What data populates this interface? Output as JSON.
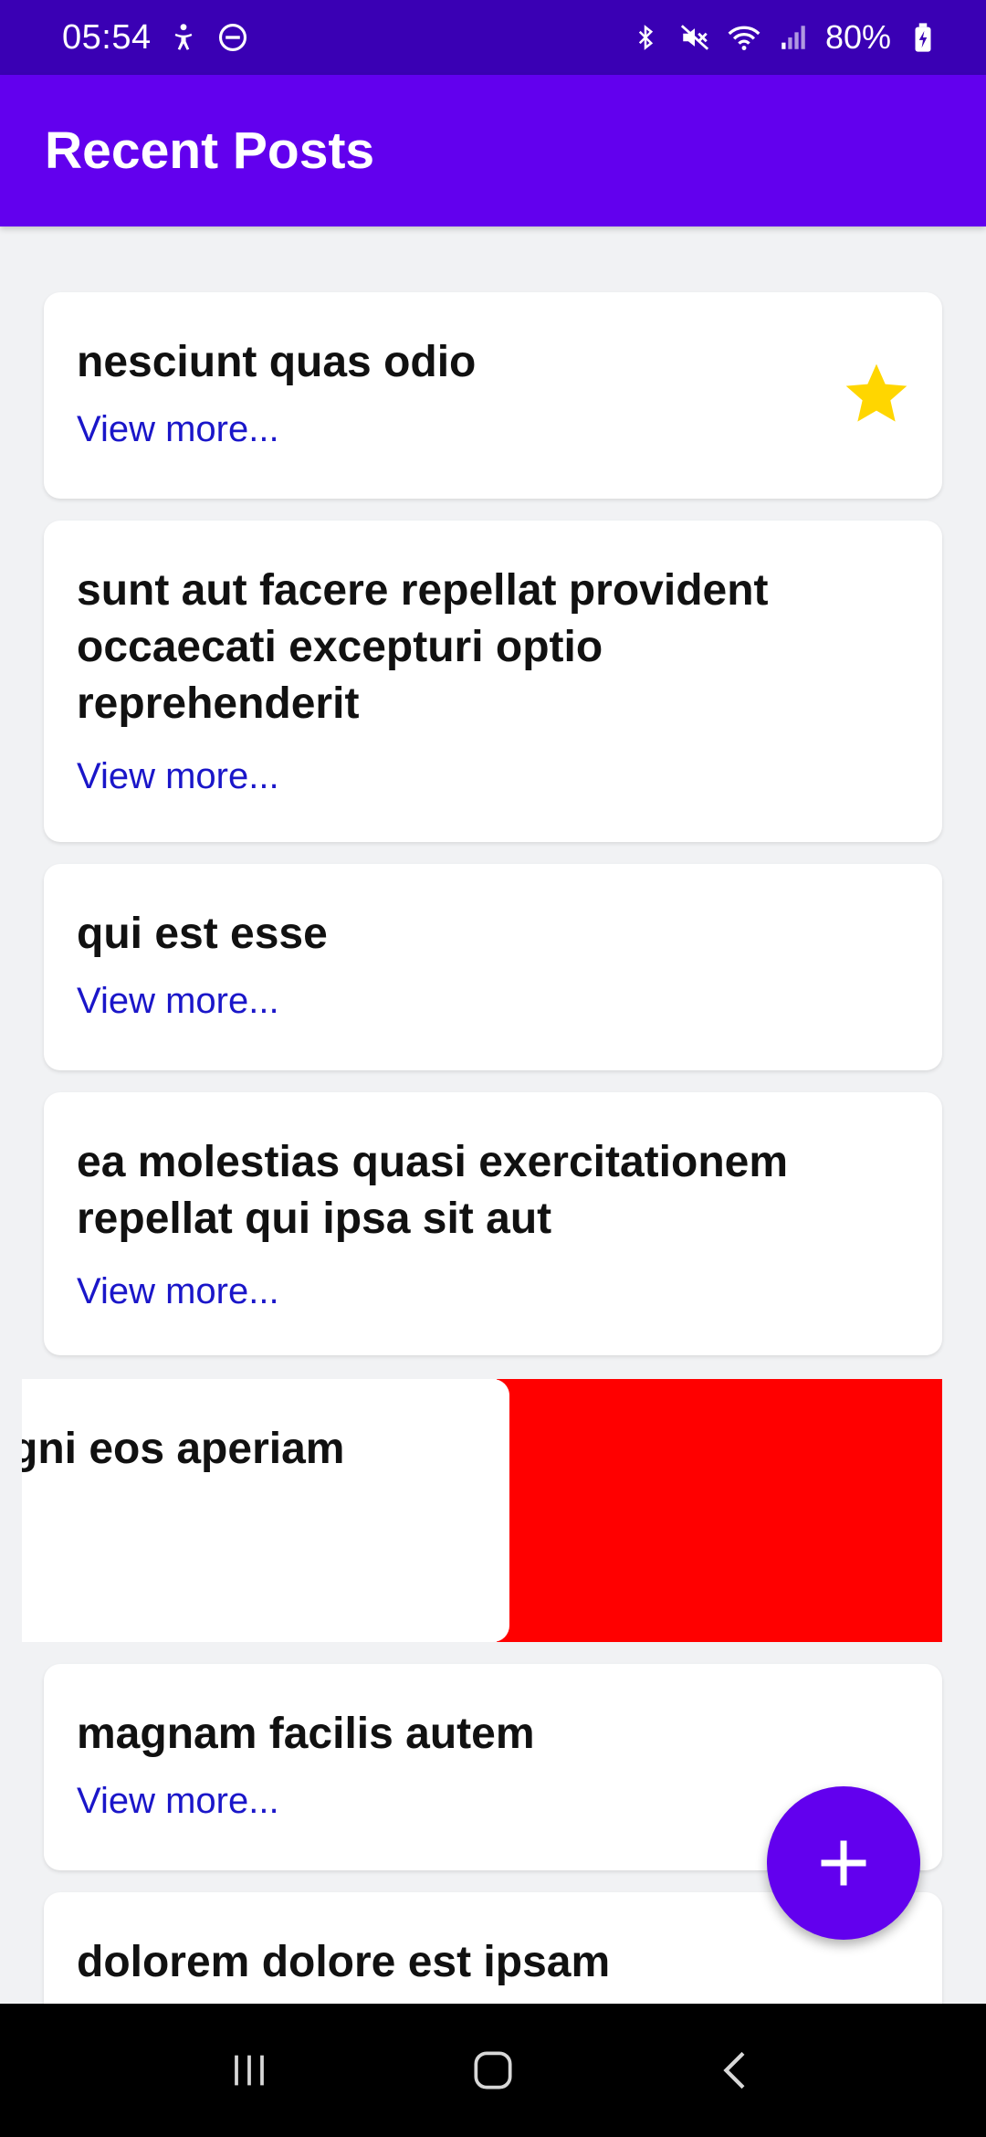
{
  "status_bar": {
    "time": "05:54",
    "battery": "80%"
  },
  "app_bar": {
    "title": "Recent Posts"
  },
  "posts": [
    {
      "title": "nesciunt quas odio",
      "link": "View more...",
      "starred": true
    },
    {
      "title": "sunt aut facere repellat provident occaecati excepturi optio reprehenderit",
      "link": "View more..."
    },
    {
      "title": "qui est esse",
      "link": "View more..."
    },
    {
      "title": "ea molestias quasi exercitationem repellat qui ipsa sit aut",
      "link": "View more..."
    },
    {
      "title": "gni eos aperiam",
      "swiped": true
    },
    {
      "title": "magnam facilis autem",
      "link": "View more..."
    },
    {
      "title": "dolorem dolore est ipsam"
    }
  ],
  "colors": {
    "status_bar": "#3a00b4",
    "app_bar": "#6200ee",
    "link": "#1a16c9",
    "star": "#ffd600",
    "swipe_delete": "#ff0000",
    "fab": "#6200ee"
  },
  "icons": {
    "star": "star-icon",
    "fab": "plus-icon",
    "nav": [
      "recent-apps-icon",
      "home-icon",
      "back-icon"
    ]
  }
}
